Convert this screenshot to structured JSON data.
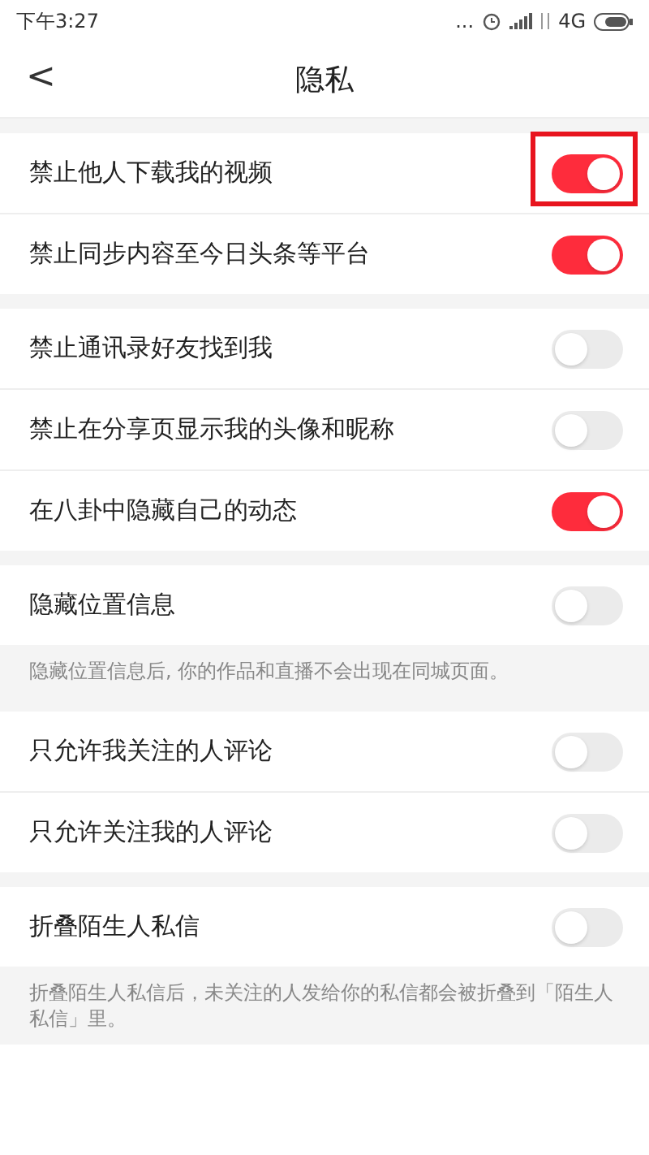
{
  "status_bar": {
    "time": "下午3:27",
    "dots": "...",
    "network": "4G"
  },
  "header": {
    "back": "<",
    "title": "隐私"
  },
  "sections": [
    {
      "items": [
        {
          "label": "禁止他人下载我的视频",
          "on": true,
          "highlighted": true
        },
        {
          "label": "禁止同步内容至今日头条等平台",
          "on": true,
          "highlighted": false
        }
      ]
    },
    {
      "items": [
        {
          "label": "禁止通讯录好友找到我",
          "on": false,
          "highlighted": false
        },
        {
          "label": "禁止在分享页显示我的头像和昵称",
          "on": false,
          "highlighted": false
        },
        {
          "label": "在八卦中隐藏自己的动态",
          "on": true,
          "highlighted": false
        }
      ]
    },
    {
      "items": [
        {
          "label": "隐藏位置信息",
          "on": false,
          "highlighted": false
        }
      ],
      "note": "隐藏位置信息后, 你的作品和直播不会出现在同城页面。"
    },
    {
      "items": [
        {
          "label": "只允许我关注的人评论",
          "on": false,
          "highlighted": false
        },
        {
          "label": "只允许关注我的人评论",
          "on": false,
          "highlighted": false
        }
      ]
    },
    {
      "items": [
        {
          "label": "折叠陌生人私信",
          "on": false,
          "highlighted": false
        }
      ],
      "note": "折叠陌生人私信后，未关注的人发给你的私信都会被折叠到「陌生人私信」里。"
    }
  ]
}
